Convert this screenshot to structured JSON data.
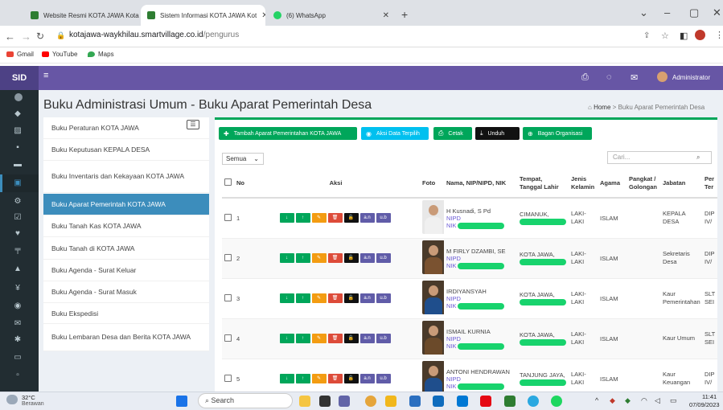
{
  "browser": {
    "tabs": [
      {
        "label": "Website Resmi KOTA JAWA Kota",
        "color": "#2e7d32"
      },
      {
        "label": "Sistem Informasi KOTA JAWA Kot",
        "color": "#2e7d32"
      },
      {
        "label": "(6) WhatsApp",
        "color": "#25d366"
      }
    ],
    "url_host": "kotajawa-waykhilau.smartvillage.co.id",
    "url_path": "/pengurus",
    "bookmarks": [
      {
        "label": "Gmail",
        "color": "#ea4335"
      },
      {
        "label": "YouTube",
        "color": "#ff0000"
      },
      {
        "label": "Maps",
        "color": "#34a853"
      }
    ]
  },
  "app": {
    "logo": "SID",
    "user": "Administrator",
    "page_title": "Buku Administrasi Umum - Buku Aparat Pemerintah Desa",
    "breadcrumb": {
      "home": "Home",
      "current": "Buku Aparat Pemerintah Desa"
    },
    "menu": [
      {
        "label": "Buku Peraturan KOTA JAWA",
        "active": false
      },
      {
        "label": "Buku Keputusan KEPALA DESA",
        "active": false
      },
      {
        "label": "Buku Inventaris dan Kekayaan KOTA JAWA",
        "active": false
      },
      {
        "label": "Buku Aparat Pemerintah KOTA JAWA",
        "active": true
      },
      {
        "label": "Buku Tanah Kas KOTA JAWA",
        "active": false
      },
      {
        "label": "Buku Tanah di KOTA JAWA",
        "active": false
      },
      {
        "label": "Buku Agenda - Surat Keluar",
        "active": false
      },
      {
        "label": "Buku Agenda - Surat Masuk",
        "active": false
      },
      {
        "label": "Buku Ekspedisi",
        "active": false
      },
      {
        "label": "Buku Lembaran Desa dan Berita KOTA JAWA",
        "active": false
      }
    ],
    "toolbar": [
      {
        "label": "Tambah Aparat Pemerintahan KOTA JAWA",
        "color": "#00a65a",
        "icon": "plus-icon"
      },
      {
        "label": "Aksi Data Terpilih",
        "color": "#00c0ef",
        "icon": "circle-check-icon"
      },
      {
        "label": "Cetak",
        "color": "#00a65a",
        "icon": "print-icon"
      },
      {
        "label": "Unduh",
        "color": "#111111",
        "icon": "download-icon"
      },
      {
        "label": "Bagan Organisasi",
        "color": "#00a65a",
        "icon": "circle-plus-icon"
      }
    ],
    "filter": {
      "value": "Semua"
    },
    "search": {
      "placeholder": "Cari..."
    },
    "table": {
      "headers": [
        "No",
        "Aksi",
        "Foto",
        "Nama, NIP/NIPD, NIK",
        "Tempat, Tanggal Lahir",
        "Jenis Kelamin",
        "Agama",
        "Pangkat / Golongan",
        "Jabatan",
        "Per Ter"
      ],
      "action_buttons": [
        {
          "label": "↓",
          "color": "#00a65a"
        },
        {
          "label": "↑",
          "color": "#00a65a"
        },
        {
          "label": "✎",
          "color": "#f39c12"
        },
        {
          "label": "🗑",
          "color": "#dd4b39"
        },
        {
          "label": "🔓",
          "color": "#111111"
        },
        {
          "label": "a.n",
          "color": "#605ca8"
        },
        {
          "label": "u.b",
          "color": "#605ca8"
        }
      ],
      "nip_label": "NIPD",
      "nik_label": "NIK",
      "rows": [
        {
          "no": "1",
          "name": "H Kusnadi, S Pd",
          "birth": "CIMANUK,",
          "gender": "LAKI-LAKI",
          "religion": "ISLAM",
          "rank": "",
          "position": "KEPALA DESA",
          "per": "DIP IV/"
        },
        {
          "no": "2",
          "name": "M FIRLY DZAMBI, SE",
          "birth": "KOTA JAWA,",
          "gender": "LAKI-LAKI",
          "religion": "ISLAM",
          "rank": "",
          "position": "Sekretaris Desa",
          "per": "DIP IV/"
        },
        {
          "no": "3",
          "name": "IRDIYANSYAH",
          "birth": "KOTA JAWA,",
          "gender": "LAKI-LAKI",
          "religion": "ISLAM",
          "rank": "",
          "position": "Kaur Pemerintahan",
          "per": "SLT SEI"
        },
        {
          "no": "4",
          "name": "ISMAIL KURNIA",
          "birth": "KOTA JAWA,",
          "gender": "LAKI-LAKI",
          "religion": "ISLAM",
          "rank": "",
          "position": "Kaur Umum",
          "per": "SLT SEI"
        },
        {
          "no": "5",
          "name": "ANTONI HENDRAWAN",
          "birth": "TANJUNG JAYA,",
          "gender": "LAKI-LAKI",
          "religion": "ISLAM",
          "rank": "",
          "position": "Kaur Keuangan",
          "per": "DIP IV/"
        }
      ]
    }
  },
  "taskbar": {
    "weather_temp": "32°C",
    "weather_text": "Berawan",
    "search": "Search",
    "time": "11:41",
    "date": "07/09/2023"
  }
}
